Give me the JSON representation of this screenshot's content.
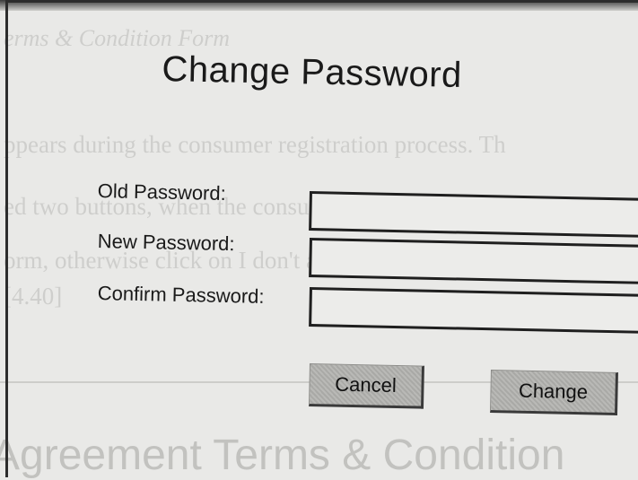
{
  "dialog": {
    "title": "Change Password",
    "fields": [
      {
        "label": "Old Password:",
        "value": ""
      },
      {
        "label": "New Password:",
        "value": ""
      },
      {
        "label": "Confirm Password:",
        "value": ""
      }
    ],
    "buttons": {
      "cancel": "Cancel",
      "change": "Change"
    }
  },
  "background_page": {
    "lines": [
      "erms & Condition Form",
      "ppears during the consumer registration process. Th",
      "ed two buttons, when the consumer clicks on the a",
      "orm, otherwise click on I don't agree button will exi",
      "[4.40]"
    ],
    "heading": "Agreement Terms & Condition"
  }
}
